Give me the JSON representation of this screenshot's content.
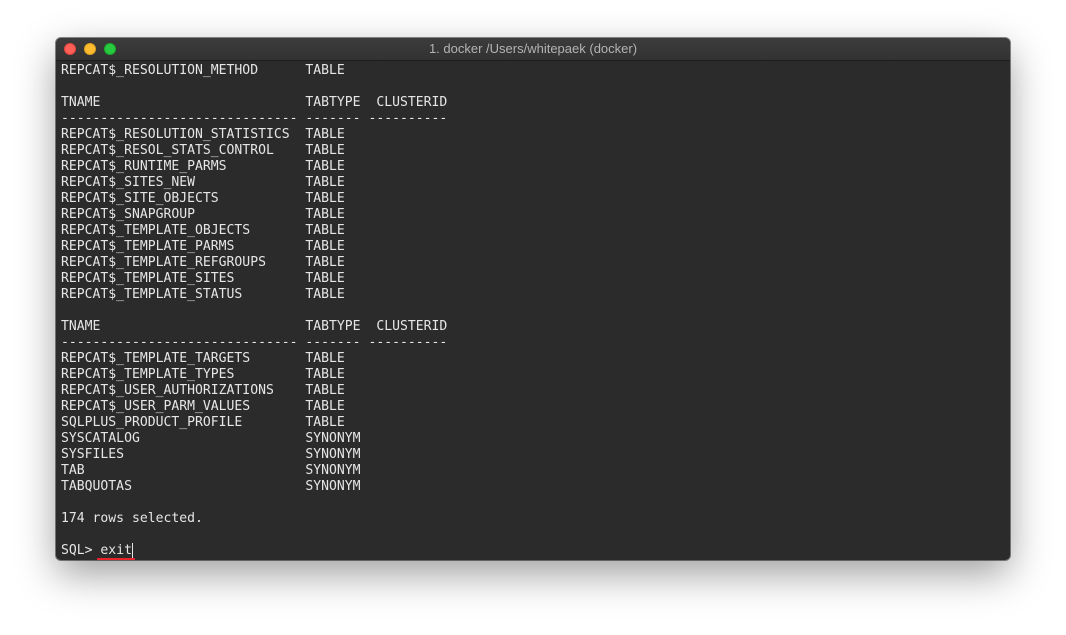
{
  "window": {
    "title": "1. docker /Users/whitepaek (docker)"
  },
  "terminal": {
    "lines": [
      "REPCAT$_RESOLUTION_METHOD      TABLE",
      "",
      "TNAME                          TABTYPE  CLUSTERID",
      "------------------------------ ------- ----------",
      "REPCAT$_RESOLUTION_STATISTICS  TABLE",
      "REPCAT$_RESOL_STATS_CONTROL    TABLE",
      "REPCAT$_RUNTIME_PARMS          TABLE",
      "REPCAT$_SITES_NEW              TABLE",
      "REPCAT$_SITE_OBJECTS           TABLE",
      "REPCAT$_SNAPGROUP              TABLE",
      "REPCAT$_TEMPLATE_OBJECTS       TABLE",
      "REPCAT$_TEMPLATE_PARMS         TABLE",
      "REPCAT$_TEMPLATE_REFGROUPS     TABLE",
      "REPCAT$_TEMPLATE_SITES         TABLE",
      "REPCAT$_TEMPLATE_STATUS        TABLE",
      "",
      "TNAME                          TABTYPE  CLUSTERID",
      "------------------------------ ------- ----------",
      "REPCAT$_TEMPLATE_TARGETS       TABLE",
      "REPCAT$_TEMPLATE_TYPES         TABLE",
      "REPCAT$_USER_AUTHORIZATIONS    TABLE",
      "REPCAT$_USER_PARM_VALUES       TABLE",
      "SQLPLUS_PRODUCT_PROFILE        TABLE",
      "SYSCATALOG                     SYNONYM",
      "SYSFILES                       SYNONYM",
      "TAB                            SYNONYM",
      "TABQUOTAS                      SYNONYM",
      "",
      "174 rows selected.",
      ""
    ],
    "prompt": "SQL> ",
    "command": "exit"
  },
  "colors": {
    "background": "#2b2b2b",
    "text": "#e6e6e6",
    "spellcheck_underline": "#e8232a"
  }
}
